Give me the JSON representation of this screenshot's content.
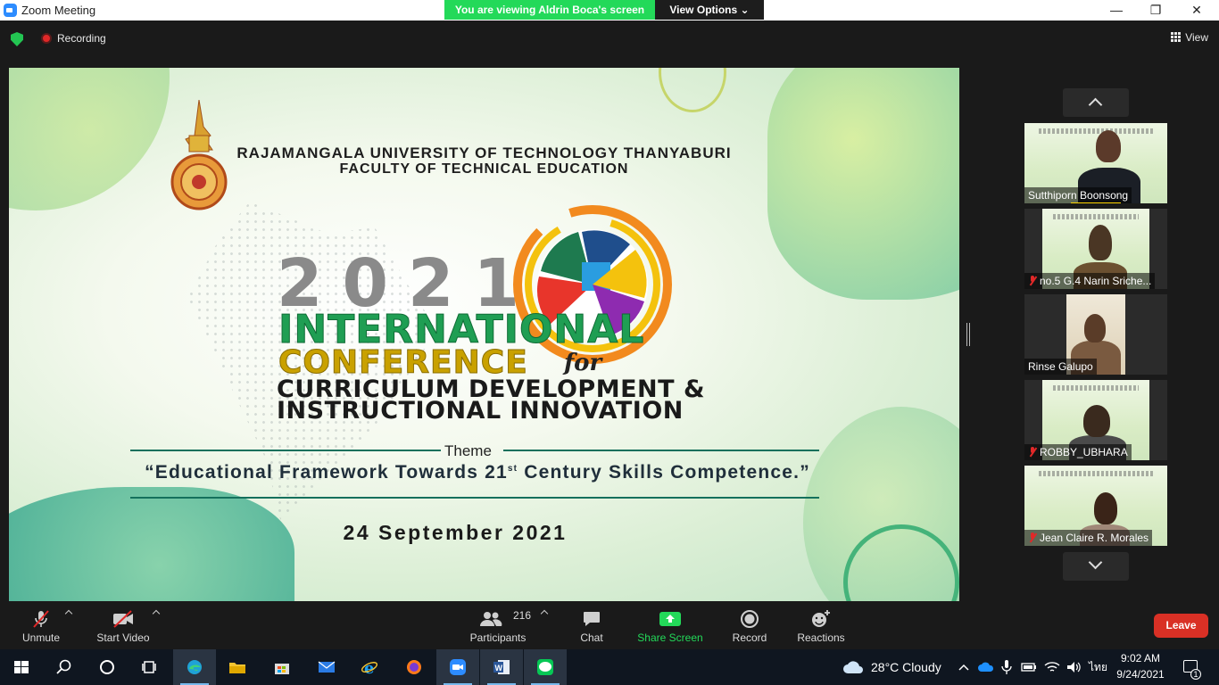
{
  "window": {
    "title": "Zoom Meeting",
    "minimize_glyph": "—",
    "restore_glyph": "❐",
    "close_glyph": "✕"
  },
  "share_banner": {
    "viewing_text": "You are viewing Aldrin Boca's screen",
    "view_options_label": "View Options",
    "view_options_caret": "⌄"
  },
  "meeting_header": {
    "recording_label": "Recording",
    "view_label": "View"
  },
  "shared_slide": {
    "university": "RAJAMANGALA UNIVERSITY OF TECHNOLOGY THANYABURI",
    "faculty": "FACULTY OF TECHNICAL EDUCATION",
    "year": "2021",
    "title_line1": "INTERNATIONAL",
    "title_line2": "CONFERENCE",
    "title_for": "for",
    "title_line3": "CURRICULUM DEVELOPMENT &",
    "title_line4": "INSTRUCTIONAL INNOVATION",
    "theme_label": "Theme",
    "theme_part1": "“Educational Framework Towards 21",
    "theme_superscript": "st",
    "theme_part2": " Century Skills Competence.”",
    "date": "24 September 2021",
    "colors": {
      "green": "#1f9e53",
      "gold": "#c9a100",
      "teal_rule": "#14705c"
    }
  },
  "gallery": {
    "participants": [
      {
        "name": "Sutthiporn Boonsong",
        "muted": false,
        "speaking": true
      },
      {
        "name": "no.5 G.4 Narin Sriche...",
        "muted": true,
        "speaking": false
      },
      {
        "name": "Rinse Galupo",
        "muted": false,
        "speaking": false
      },
      {
        "name": "ROBBY_UBHARA",
        "muted": true,
        "speaking": false
      },
      {
        "name": "Jean Claire R. Morales",
        "muted": true,
        "speaking": false
      }
    ]
  },
  "toolbar": {
    "unmute_label": "Unmute",
    "start_video_label": "Start Video",
    "participants_label": "Participants",
    "participants_count": "216",
    "chat_label": "Chat",
    "share_screen_label": "Share Screen",
    "record_label": "Record",
    "reactions_label": "Reactions",
    "leave_label": "Leave",
    "share_color": "#23d959",
    "leave_color": "#d93025"
  },
  "taskbar": {
    "weather": "28°C  Cloudy",
    "language": "ไทย",
    "time": "9:02 AM",
    "date": "9/24/2021",
    "notification_count": "1",
    "pinned_apps": [
      "start-icon",
      "search-icon",
      "cortana-icon",
      "task-view-icon",
      "edge-icon",
      "file-explorer-icon",
      "store-icon",
      "mail-icon",
      "internet-explorer-icon",
      "firefox-icon",
      "zoom-icon",
      "word-icon",
      "line-icon"
    ]
  }
}
